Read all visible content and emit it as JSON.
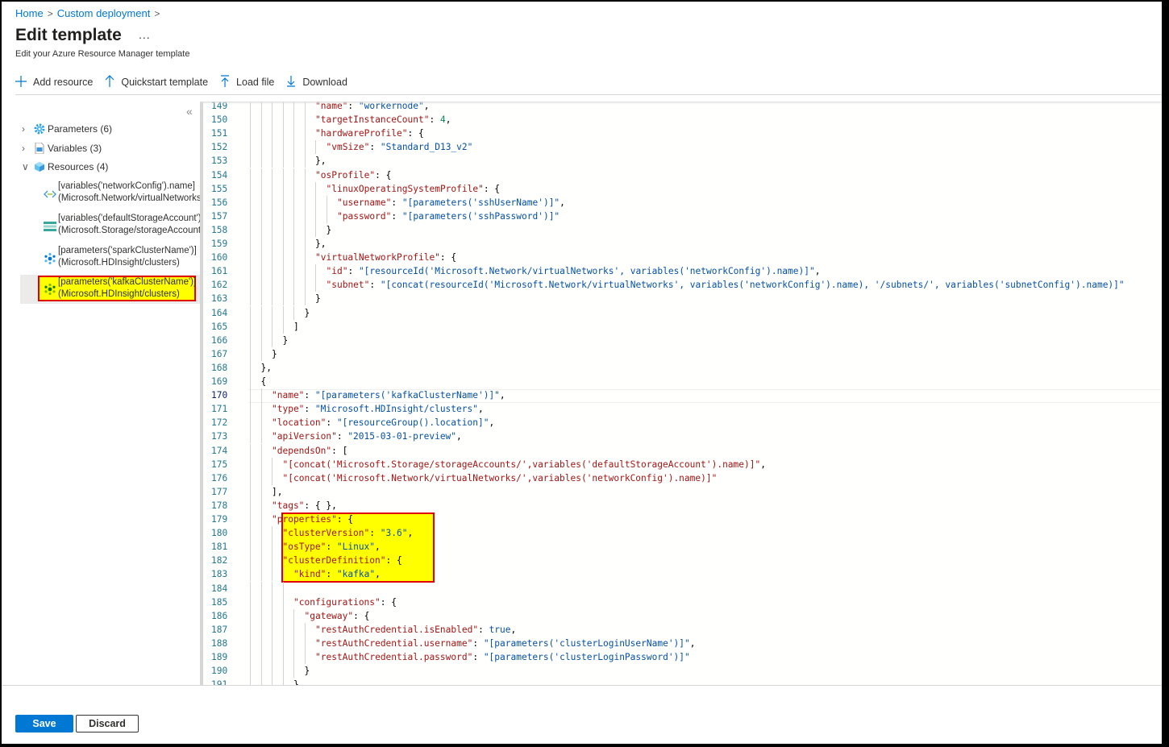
{
  "breadcrumb": [
    "Home",
    "Custom deployment"
  ],
  "header": {
    "title": "Edit template",
    "more": "...",
    "subtitle": "Edit your Azure Resource Manager template"
  },
  "toolbar": {
    "add_resource": "Add resource",
    "quickstart": "Quickstart template",
    "load_file": "Load file",
    "download": "Download"
  },
  "sidebar": {
    "collapse_icon": "«",
    "groups": [
      {
        "label": "Parameters (6)",
        "icon": "gear-icon",
        "expanded": false
      },
      {
        "label": "Variables (3)",
        "icon": "document-icon",
        "expanded": false
      },
      {
        "label": "Resources (4)",
        "icon": "cube-icon",
        "expanded": true
      }
    ],
    "resources": [
      {
        "line1": "[variables('networkConfig').name]",
        "line2": "(Microsoft.Network/virtualNetworks)",
        "icon": "virtual-network-icon"
      },
      {
        "line1": "[variables('defaultStorageAccount').name]",
        "line2": "(Microsoft.Storage/storageAccounts)",
        "icon": "storage-account-icon"
      },
      {
        "line1": "[parameters('sparkClusterName')]",
        "line2": "(Microsoft.HDInsight/clusters)",
        "icon": "hdinsight-cluster-icon"
      },
      {
        "line1": "[parameters('kafkaClusterName')]",
        "line2": "(Microsoft.HDInsight/clusters)",
        "icon": "hdinsight-cluster-icon",
        "selected": true
      }
    ]
  },
  "editor": {
    "active_line": 170,
    "highlighted_lines": [
      179,
      183
    ],
    "lines": [
      {
        "n": 149,
        "indent": 6,
        "tokens": [
          [
            "k",
            "\"name\""
          ],
          [
            "p",
            ": "
          ],
          [
            "s",
            "\"workernode\""
          ],
          [
            "p",
            ","
          ]
        ]
      },
      {
        "n": 150,
        "indent": 6,
        "tokens": [
          [
            "k",
            "\"targetInstanceCount\""
          ],
          [
            "p",
            ": "
          ],
          [
            "n",
            "4"
          ],
          [
            "p",
            ","
          ]
        ]
      },
      {
        "n": 151,
        "indent": 6,
        "tokens": [
          [
            "k",
            "\"hardwareProfile\""
          ],
          [
            "p",
            ": {"
          ]
        ]
      },
      {
        "n": 152,
        "indent": 7,
        "tokens": [
          [
            "k",
            "\"vmSize\""
          ],
          [
            "p",
            ": "
          ],
          [
            "s",
            "\"Standard_D13_v2\""
          ]
        ]
      },
      {
        "n": 153,
        "indent": 6,
        "tokens": [
          [
            "p",
            "},"
          ]
        ]
      },
      {
        "n": 154,
        "indent": 6,
        "tokens": [
          [
            "k",
            "\"osProfile\""
          ],
          [
            "p",
            ": {"
          ]
        ]
      },
      {
        "n": 155,
        "indent": 7,
        "tokens": [
          [
            "k",
            "\"linuxOperatingSystemProfile\""
          ],
          [
            "p",
            ": {"
          ]
        ]
      },
      {
        "n": 156,
        "indent": 8,
        "tokens": [
          [
            "k",
            "\"username\""
          ],
          [
            "p",
            ": "
          ],
          [
            "s",
            "\"[parameters('sshUserName')]\""
          ],
          [
            "p",
            ","
          ]
        ]
      },
      {
        "n": 157,
        "indent": 8,
        "tokens": [
          [
            "k",
            "\"password\""
          ],
          [
            "p",
            ": "
          ],
          [
            "s",
            "\"[parameters('sshPassword')]\""
          ]
        ]
      },
      {
        "n": 158,
        "indent": 7,
        "tokens": [
          [
            "p",
            "}"
          ]
        ]
      },
      {
        "n": 159,
        "indent": 6,
        "tokens": [
          [
            "p",
            "},"
          ]
        ]
      },
      {
        "n": 160,
        "indent": 6,
        "tokens": [
          [
            "k",
            "\"virtualNetworkProfile\""
          ],
          [
            "p",
            ": {"
          ]
        ]
      },
      {
        "n": 161,
        "indent": 7,
        "tokens": [
          [
            "k",
            "\"id\""
          ],
          [
            "p",
            ": "
          ],
          [
            "s",
            "\"[resourceId('Microsoft.Network/virtualNetworks', variables('networkConfig').name)]\""
          ],
          [
            "p",
            ","
          ]
        ]
      },
      {
        "n": 162,
        "indent": 7,
        "tokens": [
          [
            "k",
            "\"subnet\""
          ],
          [
            "p",
            ": "
          ],
          [
            "s",
            "\"[concat(resourceId('Microsoft.Network/virtualNetworks', variables('networkConfig').name), '/subnets/', variables('subnetConfig').name)]\""
          ]
        ]
      },
      {
        "n": 163,
        "indent": 6,
        "tokens": [
          [
            "p",
            "}"
          ]
        ]
      },
      {
        "n": 164,
        "indent": 5,
        "tokens": [
          [
            "p",
            "}"
          ]
        ]
      },
      {
        "n": 165,
        "indent": 4,
        "tokens": [
          [
            "p",
            "]"
          ]
        ]
      },
      {
        "n": 166,
        "indent": 3,
        "tokens": [
          [
            "p",
            "}"
          ]
        ]
      },
      {
        "n": 167,
        "indent": 2,
        "tokens": [
          [
            "p",
            "}"
          ]
        ]
      },
      {
        "n": 168,
        "indent": 1,
        "tokens": [
          [
            "p",
            "},"
          ]
        ]
      },
      {
        "n": 169,
        "indent": 1,
        "tokens": [
          [
            "p",
            "{"
          ]
        ]
      },
      {
        "n": 170,
        "indent": 2,
        "tokens": [
          [
            "k",
            "\"name\""
          ],
          [
            "p",
            ": "
          ],
          [
            "s",
            "\"[parameters('kafkaClusterName')]\""
          ],
          [
            "p",
            ","
          ]
        ]
      },
      {
        "n": 171,
        "indent": 2,
        "tokens": [
          [
            "k",
            "\"type\""
          ],
          [
            "p",
            ": "
          ],
          [
            "s",
            "\"Microsoft.HDInsight/clusters\""
          ],
          [
            "p",
            ","
          ]
        ]
      },
      {
        "n": 172,
        "indent": 2,
        "tokens": [
          [
            "k",
            "\"location\""
          ],
          [
            "p",
            ": "
          ],
          [
            "s",
            "\"[resourceGroup().location]\""
          ],
          [
            "p",
            ","
          ]
        ]
      },
      {
        "n": 173,
        "indent": 2,
        "tokens": [
          [
            "k",
            "\"apiVersion\""
          ],
          [
            "p",
            ": "
          ],
          [
            "s",
            "\"2015-03-01-preview\""
          ],
          [
            "p",
            ","
          ]
        ]
      },
      {
        "n": 174,
        "indent": 2,
        "tokens": [
          [
            "k",
            "\"dependsOn\""
          ],
          [
            "p",
            ": ["
          ]
        ]
      },
      {
        "n": 175,
        "indent": 3,
        "tokens": [
          [
            "k",
            "\"[concat('Microsoft.Storage/storageAccounts/',variables('defaultStorageAccount').name)]\""
          ],
          [
            "p",
            ","
          ]
        ]
      },
      {
        "n": 176,
        "indent": 3,
        "tokens": [
          [
            "k",
            "\"[concat('Microsoft.Network/virtualNetworks/',variables('networkConfig').name)]\""
          ]
        ]
      },
      {
        "n": 177,
        "indent": 2,
        "tokens": [
          [
            "p",
            "],"
          ]
        ]
      },
      {
        "n": 178,
        "indent": 2,
        "tokens": [
          [
            "k",
            "\"tags\""
          ],
          [
            "p",
            ": { },"
          ]
        ]
      },
      {
        "n": 179,
        "indent": 2,
        "tokens": [
          [
            "k",
            "\"properties\""
          ],
          [
            "p",
            ": {"
          ]
        ]
      },
      {
        "n": 180,
        "indent": 3,
        "tokens": [
          [
            "k",
            "\"clusterVersion\""
          ],
          [
            "p",
            ": "
          ],
          [
            "s",
            "\"3.6\""
          ],
          [
            "p",
            ","
          ]
        ]
      },
      {
        "n": 181,
        "indent": 3,
        "tokens": [
          [
            "k",
            "\"osType\""
          ],
          [
            "p",
            ": "
          ],
          [
            "s",
            "\"Linux\""
          ],
          [
            "p",
            ","
          ]
        ]
      },
      {
        "n": 182,
        "indent": 3,
        "tokens": [
          [
            "k",
            "\"clusterDefinition\""
          ],
          [
            "p",
            ": {"
          ]
        ]
      },
      {
        "n": 183,
        "indent": 4,
        "tokens": [
          [
            "k",
            "\"kind\""
          ],
          [
            "p",
            ": "
          ],
          [
            "s",
            "\"kafka\""
          ],
          [
            "p",
            ","
          ]
        ]
      },
      {
        "n": 184,
        "indent": 4,
        "tokens": []
      },
      {
        "n": 185,
        "indent": 4,
        "tokens": [
          [
            "k",
            "\"configurations\""
          ],
          [
            "p",
            ": {"
          ]
        ]
      },
      {
        "n": 186,
        "indent": 5,
        "tokens": [
          [
            "k",
            "\"gateway\""
          ],
          [
            "p",
            ": {"
          ]
        ]
      },
      {
        "n": 187,
        "indent": 6,
        "tokens": [
          [
            "k",
            "\"restAuthCredential.isEnabled\""
          ],
          [
            "p",
            ": "
          ],
          [
            "b",
            "true"
          ],
          [
            "p",
            ","
          ]
        ]
      },
      {
        "n": 188,
        "indent": 6,
        "tokens": [
          [
            "k",
            "\"restAuthCredential.username\""
          ],
          [
            "p",
            ": "
          ],
          [
            "s",
            "\"[parameters('clusterLoginUserName')]\""
          ],
          [
            "p",
            ","
          ]
        ]
      },
      {
        "n": 189,
        "indent": 6,
        "tokens": [
          [
            "k",
            "\"restAuthCredential.password\""
          ],
          [
            "p",
            ": "
          ],
          [
            "s",
            "\"[parameters('clusterLoginPassword')]\""
          ]
        ]
      },
      {
        "n": 190,
        "indent": 5,
        "tokens": [
          [
            "p",
            "}"
          ]
        ]
      },
      {
        "n": 191,
        "indent": 4,
        "tokens": [
          [
            "p",
            "}"
          ]
        ]
      }
    ]
  },
  "footer": {
    "save": "Save",
    "discard": "Discard"
  }
}
